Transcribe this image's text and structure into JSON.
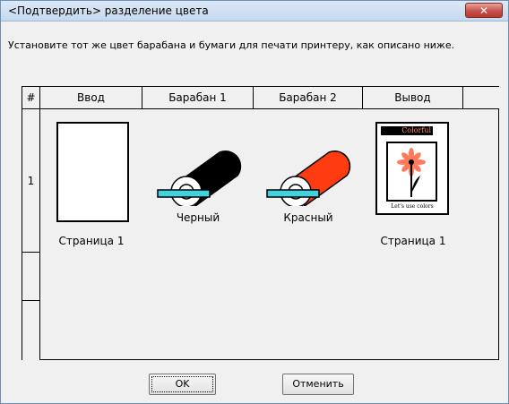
{
  "window": {
    "title": "<Подтвердить> разделение цвета",
    "close_glyph": "✕"
  },
  "instruction": "Установите тот же цвет барабана и бумаги для печати принтеру, как описано ниже.",
  "table": {
    "headers": [
      "#",
      "Ввод",
      "Барабан 1",
      "Барабан 2",
      "Вывод",
      ""
    ],
    "rows": [
      {
        "index": "1",
        "input_label": "Страница 1",
        "drum1_label": "Черный",
        "drum1_color": "#000000",
        "drum2_label": "Красный",
        "drum2_color": "#ff3b12",
        "output_label": "Страница 1",
        "output_preview": {
          "heading": "Colorful",
          "caption": "Let's use colors"
        }
      }
    ]
  },
  "buttons": {
    "ok": "OK",
    "cancel": "Отменить"
  },
  "colors": {
    "roller_tray": "#3fd3e0"
  }
}
